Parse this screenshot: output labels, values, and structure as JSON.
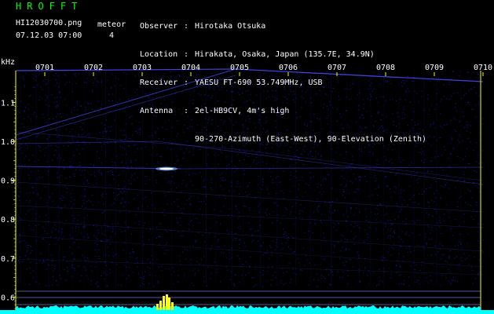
{
  "header": {
    "brand": "HROFFT",
    "filename": "HI12030700.png",
    "datetime": "07.12.03 07:00",
    "meteor_label": "meteor",
    "meteor_count": "4"
  },
  "station": {
    "rows": [
      {
        "key": "Observer",
        "value": "Hirotaka Otsuka"
      },
      {
        "key": "Location",
        "value": "Hirakata, Osaka, Japan (135.7E, 34.9N)"
      },
      {
        "key": "Receiver",
        "value": "YAESU FT-690 53.749MHz, USB"
      },
      {
        "key": "Antenna",
        "value": "2el-HB9CV, 4m's high"
      },
      {
        "key": "",
        "value": "90-270-Azimuth (East-West), 90-Elevation (Zenith)"
      }
    ]
  },
  "chart_data": {
    "type": "heatmap",
    "ylabel": "kHz",
    "x_ticks": [
      "0701",
      "0702",
      "0703",
      "0704",
      "0705",
      "0706",
      "0707",
      "0708",
      "0709",
      "0710"
    ],
    "y_ticks": [
      1.1,
      1.0,
      0.9,
      0.8,
      0.7,
      0.6
    ],
    "colors": {
      "background": "#000000",
      "noise": "#1a1acc",
      "signal": "#ffffff",
      "axis": "#ffff00",
      "level": "#00ffff"
    }
  }
}
